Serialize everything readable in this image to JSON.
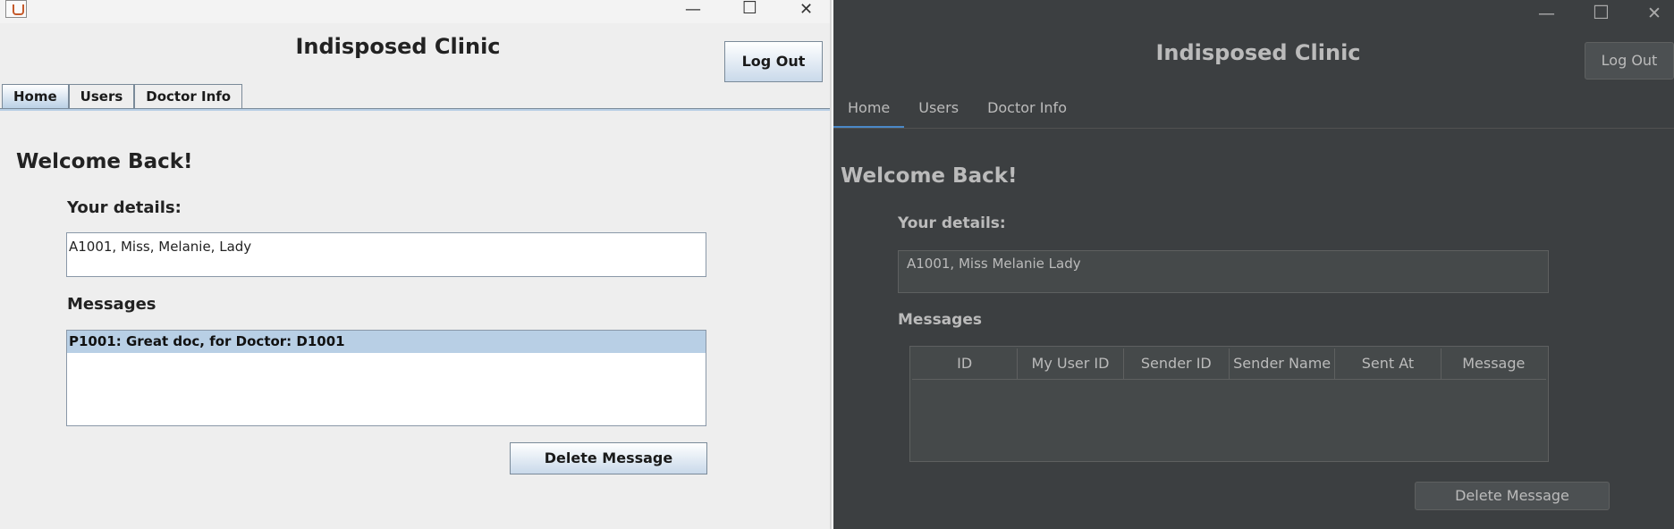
{
  "left_window": {
    "controls": {
      "minimize": "—",
      "maximize": "☐",
      "close": "✕"
    },
    "app_title": "Indisposed Clinic",
    "logout_label": "Log Out",
    "tabs": [
      "Home",
      "Users",
      "Doctor Info"
    ],
    "active_tab": "Home",
    "welcome": "Welcome Back!",
    "details_label": "Your details:",
    "details_value": "A1001, Miss, Melanie, Lady",
    "messages_label": "Messages",
    "messages": [
      "P1001: Great doc, for Doctor: D1001"
    ],
    "delete_label": "Delete Message",
    "colors": {
      "background": "#eeeeee",
      "selection": "#b8cfe5"
    }
  },
  "right_window": {
    "controls": {
      "minimize": "—",
      "maximize": "☐",
      "close": "✕"
    },
    "app_title": "Indisposed Clinic",
    "logout_label": "Log Out",
    "tabs": [
      "Home",
      "Users",
      "Doctor Info"
    ],
    "active_tab": "Home",
    "welcome": "Welcome Back!",
    "details_label": "Your details:",
    "details_value": "A1001, Miss Melanie Lady",
    "messages_label": "Messages",
    "table_columns": [
      "ID",
      "My User ID",
      "Sender ID",
      "Sender Name",
      "Sent At",
      "Message"
    ],
    "delete_label": "Delete Message",
    "colors": {
      "background": "#3c3f41",
      "accent": "#4a88c7"
    }
  }
}
